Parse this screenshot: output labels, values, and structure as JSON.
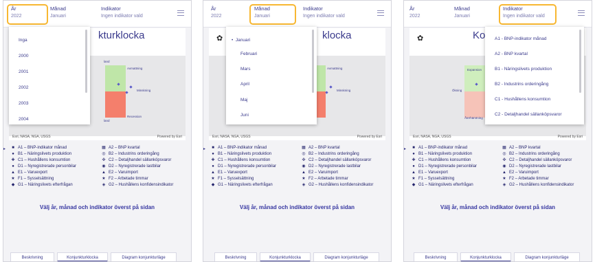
{
  "filters": {
    "year_label": "År",
    "year_value": "2022",
    "month_label": "Månad",
    "month_value": "Januari",
    "indicator_label": "Indikator",
    "indicator_value": "Ingen indikator vald"
  },
  "map": {
    "title_p1": "kturklocka",
    "title_p2": "klocka",
    "title_p3": "Ko",
    "quadrants": [
      "Expansion",
      "Avmattning",
      "Återhämtning",
      "Recession"
    ],
    "visible_p1": [
      "land",
      "Avmattning",
      "Minskning",
      "Recession",
      "land"
    ],
    "visible_p2": [
      "Avmattning",
      "Minskning"
    ],
    "visible_p3": [
      "Expansion",
      "Ökning",
      "Återhämtning"
    ],
    "credit_left": "Esri, NASA, NGA, USGS",
    "credit_right": "Powered by Esri"
  },
  "legend": [
    {
      "icon": "square-icon",
      "glyph": "■",
      "text": "A1 – BNP-indikator månad"
    },
    {
      "icon": "square-grid-icon",
      "glyph": "▦",
      "text": "A2 – BNP kvartal"
    },
    {
      "icon": "circle-icon",
      "glyph": "●",
      "text": "B1 – Näringslivets produktion"
    },
    {
      "icon": "circle-target-icon",
      "glyph": "◎",
      "text": "B2 – Industrins orderingång"
    },
    {
      "icon": "cross-icon",
      "glyph": "✚",
      "text": "C1 – Hushållens konsumtion"
    },
    {
      "icon": "cross-outline-icon",
      "glyph": "✜",
      "text": "C2 – Detaljhandel sällanköpsvaror"
    },
    {
      "icon": "circle-icon",
      "glyph": "●",
      "text": "D1 – Nyregistrerade personbilar"
    },
    {
      "icon": "circle-half-icon",
      "glyph": "◉",
      "text": "D2 – Nyregistrerade lastbilar"
    },
    {
      "icon": "triangle-icon",
      "glyph": "▲",
      "text": "E1 – Varuexport"
    },
    {
      "icon": "triangle-outline-icon",
      "glyph": "▲",
      "text": "E2 – Varuimport"
    },
    {
      "icon": "star-icon",
      "glyph": "★",
      "text": "F1 – Sysselsättning"
    },
    {
      "icon": "star-outline-icon",
      "glyph": "★",
      "text": "F2 – Arbetade timmar"
    },
    {
      "icon": "diamond-icon",
      "glyph": "◆",
      "text": "G1 – Näringslivets efterfrågan"
    },
    {
      "icon": "diamond-outline-icon",
      "glyph": "◈",
      "text": "G2 – Hushållens konfidensindikator"
    }
  ],
  "instruction": "Välj år, månad och indikator överst på sidan",
  "tabs": [
    "Beskrivning",
    "Konjunkturklocka",
    "Diagram konjunkturläge"
  ],
  "year_options": [
    "Inga",
    "2000",
    "2001",
    "2002",
    "2003",
    "2004"
  ],
  "month_options": [
    "Januari",
    "Februari",
    "Mars",
    "April",
    "Maj",
    "Juni"
  ],
  "indicator_options": [
    "A1 - BNP-indikator månad",
    "A2 - BNP kvartal",
    "B1 - Näringslivets produktion",
    "B2 - Industrins orderingång",
    "C1 - Hushållens konsumtion",
    "C2 - Detaljhandel sällanköpsvaror"
  ],
  "colors": {
    "highlight": "#f7b731",
    "accent": "#3a3a8c",
    "green": "#bfe6a8",
    "red": "#f47f6c"
  }
}
